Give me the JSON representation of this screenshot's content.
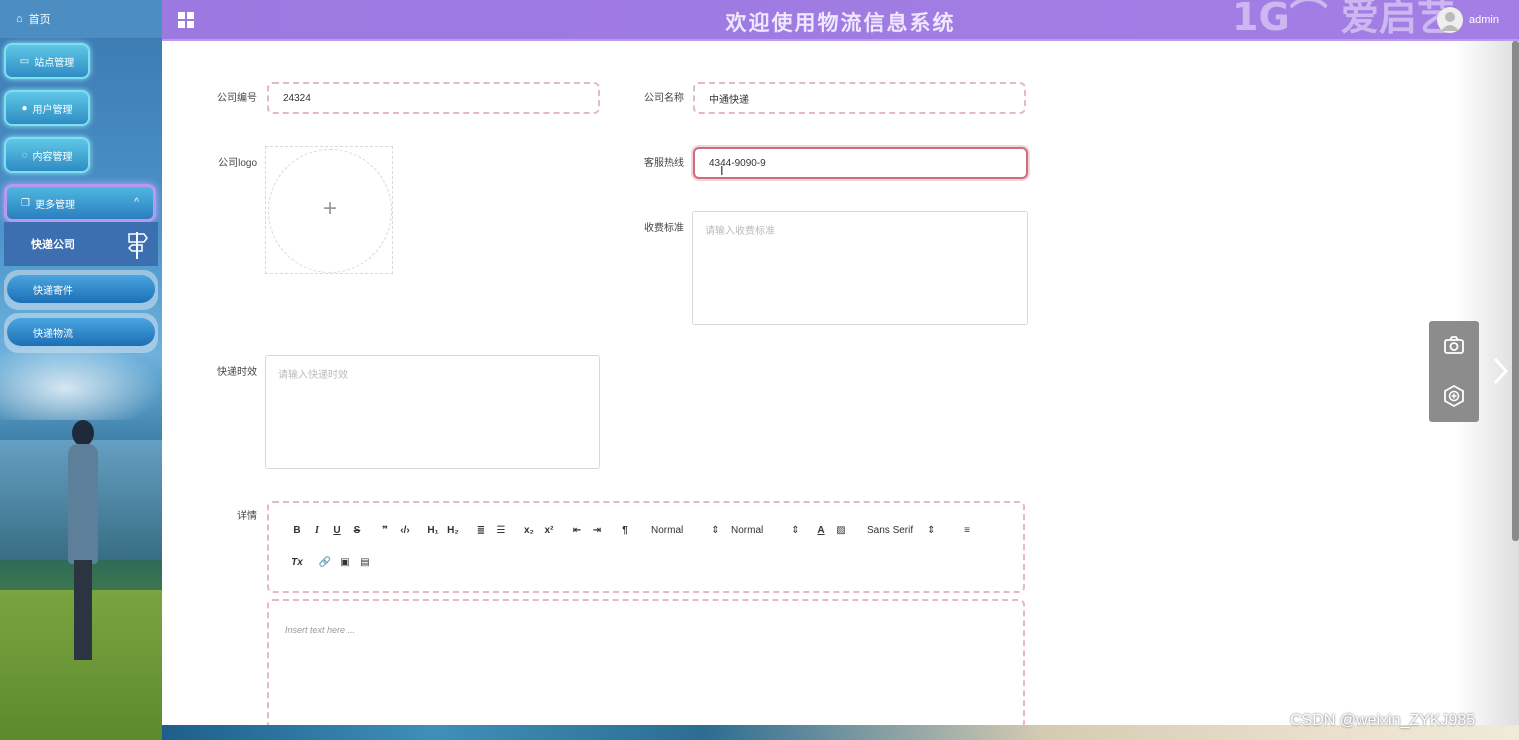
{
  "sidebar": {
    "home": "首页",
    "items": [
      {
        "label": "站点管理"
      },
      {
        "label": "用户管理"
      },
      {
        "label": "内容管理"
      }
    ],
    "more": "更多管理",
    "submenu_title": "快递公司",
    "subitems": [
      {
        "label": "快递寄件"
      },
      {
        "label": "快递物流"
      }
    ]
  },
  "header": {
    "title": "欢迎使用物流信息系统",
    "watermark": "1G⌒ 爱启艺",
    "user": "admin"
  },
  "form": {
    "company_code_label": "公司编号",
    "company_code_value": "24324",
    "company_name_label": "公司名称",
    "company_name_value": "中通快递",
    "logo_label": "公司logo",
    "hotline_label": "客服热线",
    "hotline_value": "4344-9090-9",
    "fee_label": "收费标准",
    "fee_placeholder": "请输入收费标准",
    "timeliness_label": "快递时效",
    "timeliness_placeholder": "请输入快递时效",
    "detail_label": "详情",
    "editor_placeholder": "Insert text here ..."
  },
  "toolbar": {
    "row1": [
      "B",
      "I",
      "U",
      "S",
      "❞",
      "‹/›",
      "H₁",
      "H₂",
      "≣",
      "☰",
      "x₂",
      "x²",
      "⇤",
      "⇥",
      "¶"
    ],
    "header_select": "Normal",
    "size_select": "Normal",
    "font_select": "Sans Serif",
    "row2": [
      "Tx",
      "🔗",
      "▣",
      "▤"
    ]
  },
  "footer": {
    "credit": "CSDN @weixin_ZYKJ985"
  },
  "colors": {
    "header_bg": "#9b79e0",
    "field_border": "#e6b8c0",
    "active_border": "#d16a7c"
  }
}
